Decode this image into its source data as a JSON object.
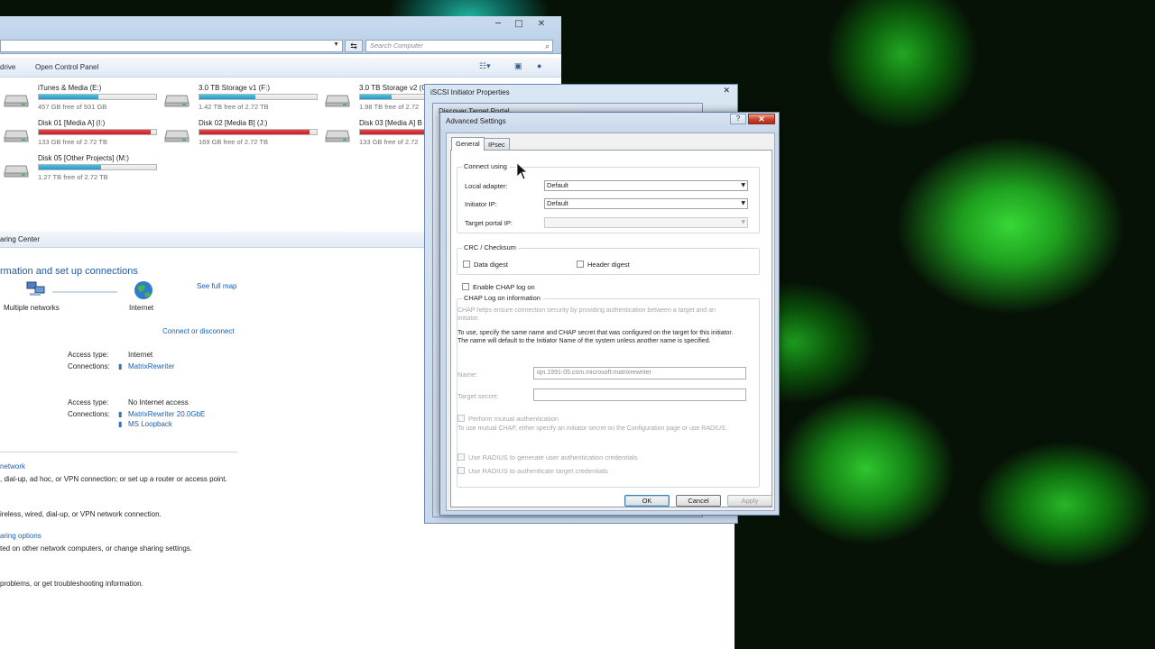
{
  "explorer": {
    "window_controls": {
      "minimize": "─",
      "maximize": "□",
      "close": "✕"
    },
    "search_placeholder": "Search Computer",
    "toolbar": {
      "drive_label": "drive",
      "control_panel_label": "Open Control Panel"
    },
    "drives": [
      {
        "name": "iTunes & Media (E:)",
        "free": "457 GB free of 931 GB",
        "used": 0.51,
        "status": "normal"
      },
      {
        "name": "3.0 TB Storage v1 (F:)",
        "free": "1.42 TB free of 2.72 TB",
        "used": 0.48,
        "status": "normal"
      },
      {
        "name": "3.0 TB Storage v2 (G:)",
        "free": "1.98 TB free of 2.72",
        "used": 0.27,
        "status": "normal"
      },
      {
        "name": "Disk 01 [Media A] (I:)",
        "free": "133 GB free of 2.72 TB",
        "used": 0.95,
        "status": "full"
      },
      {
        "name": "Disk 02 [Media B] (J:)",
        "free": "169 GB free of 2.72 TB",
        "used": 0.94,
        "status": "full"
      },
      {
        "name": "Disk 03 [Media A] B",
        "free": "133 GB free of 2.72",
        "used": 0.95,
        "status": "full"
      },
      {
        "name": "Disk 05 [Other Projects] (M:)",
        "free": "1.27 TB free of 2.72 TB",
        "used": 0.53,
        "status": "normal"
      }
    ]
  },
  "network": {
    "breadcrumb": "aring Center",
    "heading": "rmation and set up connections",
    "see_full_map": "See full map",
    "multiple_networks": "Multiple networks",
    "internet": "Internet",
    "connect_disconnect": "Connect or disconnect",
    "networks": [
      {
        "access_label": "Access type:",
        "access_value": "Internet",
        "connections_label": "Connections:",
        "connections": [
          "MatrixRewriter"
        ]
      },
      {
        "access_label": "Access type:",
        "access_value": "No Internet access",
        "connections_label": "Connections:",
        "connections": [
          "MatrixRewriter 20.0GbE",
          "MS Loopback"
        ]
      }
    ],
    "tasks": [
      {
        "link": "network",
        "desc": ", dial-up, ad hoc, or VPN connection; or set up a router or access point."
      },
      {
        "link": "",
        "desc": "ireless, wired, dial-up, or VPN network connection."
      },
      {
        "link": "aring options",
        "desc": "ted on other network computers, or change sharing settings."
      },
      {
        "link": "",
        "desc": "problems, or get troubleshooting information."
      }
    ]
  },
  "iscsi": {
    "title": "iSCSI Initiator Properties",
    "discover_title": "Discover Target Portal",
    "close": "✕"
  },
  "advanced": {
    "title": "Advanced Settings",
    "help": "?",
    "close": "✕",
    "tabs": [
      "General",
      "IPsec"
    ],
    "connect_using": {
      "group_label": "Connect using",
      "local_adapter_label": "Local adapter:",
      "local_adapter_value": "Default",
      "initiator_ip_label": "Initiator IP:",
      "initiator_ip_value": "Default",
      "target_portal_label": "Target portal IP:",
      "target_portal_value": ""
    },
    "crc": {
      "group_label": "CRC / Checksum",
      "data_digest": "Data digest",
      "header_digest": "Header digest"
    },
    "chap": {
      "enable_label": "Enable CHAP log on",
      "group_label": "CHAP Log on information",
      "help_text": "CHAP helps ensure connection security by providing authentication between a target and an initiator.",
      "instructions": "To use, specify the same name and CHAP secret that was configured on the target for this initiator.  The name will default to the Initiator Name of the system unless another name is specified.",
      "name_label": "Name:",
      "name_value": "iqn.1991-05.com.microsoft:matrixrewriter",
      "secret_label": "Target secret:",
      "secret_value": "",
      "mutual_label": "Perform mutual authentication",
      "mutual_help": "To use mutual CHAP, either specify an initiator secret on the Configuration page or use RADIUS.",
      "radius_generate": "Use RADIUS to generate user authentication credentials",
      "radius_authenticate": "Use RADIUS to authenticate target credentials"
    },
    "buttons": {
      "ok": "OK",
      "cancel": "Cancel",
      "apply": "Apply"
    }
  },
  "colors": {
    "accent_link": "#1a5fb4",
    "drive_normal": "#2699c8",
    "drive_full": "#c21d24",
    "desktop_green": "#2fc62f"
  }
}
